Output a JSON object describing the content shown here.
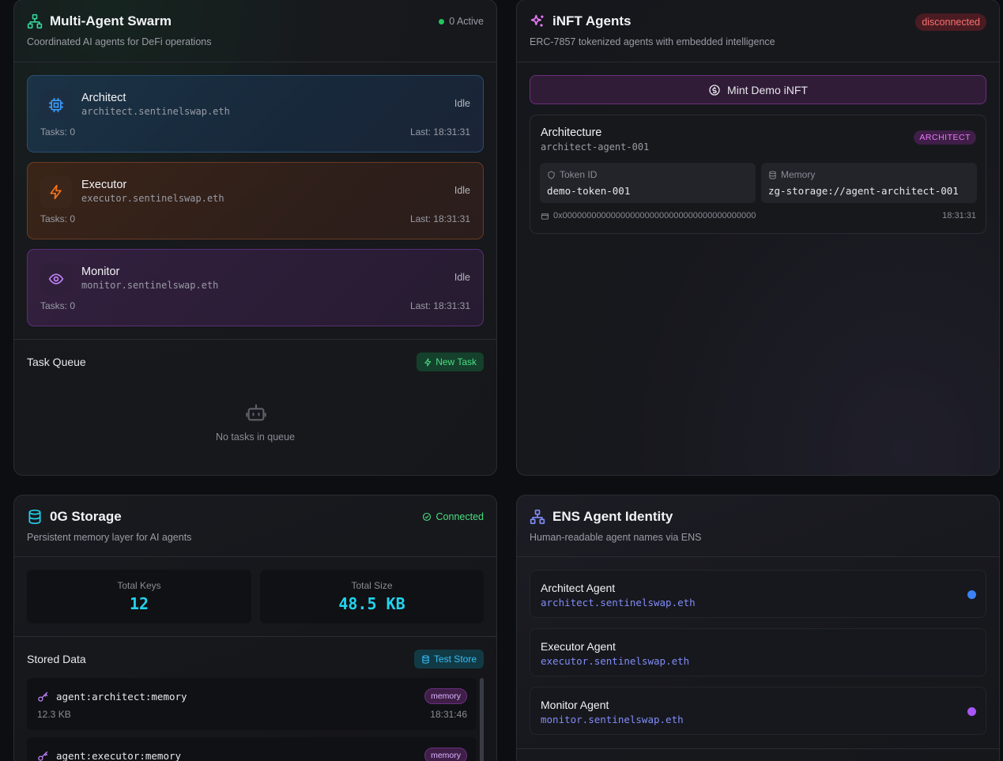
{
  "swarm": {
    "title": "Multi-Agent Swarm",
    "subtitle": "Coordinated AI agents for DeFi operations",
    "active_label": "0 Active",
    "agents": [
      {
        "name": "Architect",
        "ens": "architect.sentinelswap.eth",
        "status": "Idle",
        "tasks": "Tasks: 0",
        "last": "Last: 18:31:31",
        "icon": "cpu-icon"
      },
      {
        "name": "Executor",
        "ens": "executor.sentinelswap.eth",
        "status": "Idle",
        "tasks": "Tasks: 0",
        "last": "Last: 18:31:31",
        "icon": "lightning-icon"
      },
      {
        "name": "Monitor",
        "ens": "monitor.sentinelswap.eth",
        "status": "Idle",
        "tasks": "Tasks: 0",
        "last": "Last: 18:31:31",
        "icon": "eye-icon"
      }
    ],
    "task_queue": {
      "title": "Task Queue",
      "new_task_label": "New Task",
      "empty_text": "No tasks in queue"
    }
  },
  "inft": {
    "title": "iNFT Agents",
    "subtitle": "ERC-7857 tokenized agents with embedded intelligence",
    "status_badge": "disconnected",
    "mint_label": "Mint Demo iNFT",
    "token": {
      "name": "Architecture",
      "agent_id": "architect-agent-001",
      "role_badge": "ARCHITECT",
      "token_id_label": "Token ID",
      "token_id": "demo-token-001",
      "memory_label": "Memory",
      "memory": "zg-storage://agent-architect-001",
      "address": "0x0000000000000000000000000000000000000000",
      "time": "18:31:31"
    }
  },
  "storage": {
    "title": "0G Storage",
    "subtitle": "Persistent memory layer for AI agents",
    "status": "Connected",
    "stats": [
      {
        "label": "Total Keys",
        "value": "12"
      },
      {
        "label": "Total Size",
        "value": "48.5 KB"
      }
    ],
    "stored_title": "Stored Data",
    "test_store_label": "Test Store",
    "items": [
      {
        "key": "agent:architect:memory",
        "badge": "memory",
        "size": "12.3 KB",
        "time": "18:31:46"
      },
      {
        "key": "agent:executor:memory",
        "badge": "memory",
        "size": "",
        "time": ""
      }
    ]
  },
  "ens": {
    "title": "ENS Agent Identity",
    "subtitle": "Human-readable agent names via ENS",
    "agents": [
      {
        "name": "Architect Agent",
        "ens": "architect.sentinelswap.eth",
        "dot_color": "#3b82f6"
      },
      {
        "name": "Executor Agent",
        "ens": "executor.sentinelswap.eth",
        "dot_color": ""
      },
      {
        "name": "Monitor Agent",
        "ens": "monitor.sentinelswap.eth",
        "dot_color": "#a855f7"
      }
    ]
  }
}
